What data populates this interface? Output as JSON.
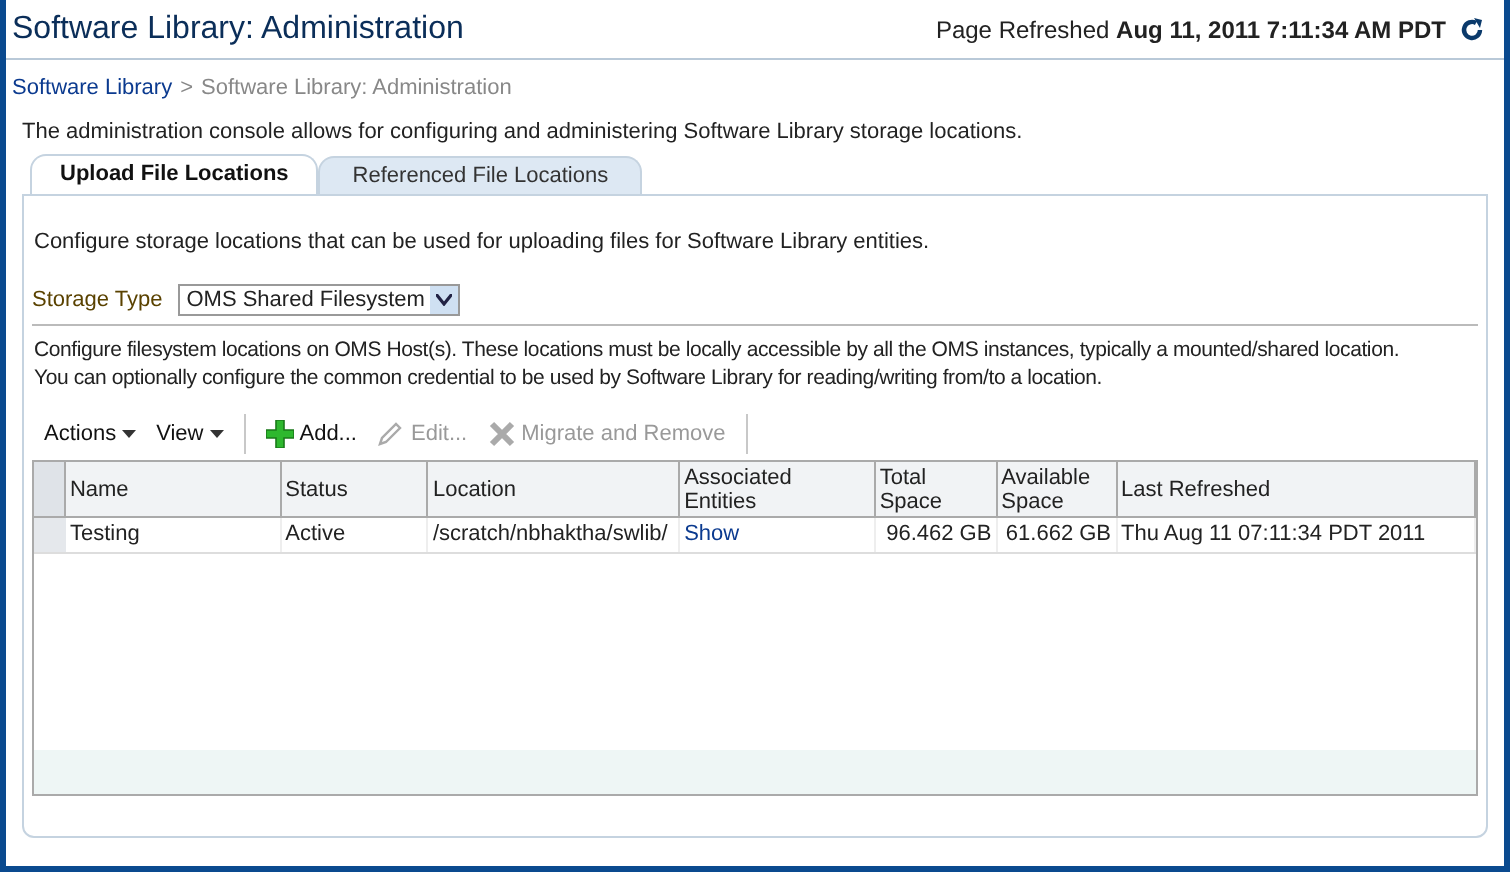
{
  "header": {
    "title": "Software Library: Administration",
    "refreshed_label": "Page Refreshed",
    "refreshed_time": "Aug 11, 2011 7:11:34 AM PDT"
  },
  "breadcrumb": [
    {
      "label": "Software Library",
      "link": true
    },
    {
      "label": ">",
      "link": false
    },
    {
      "label": "Software Library: Administration",
      "link": false
    }
  ],
  "description": "The administration console allows for configuring and administering Software Library storage locations.",
  "tabs": [
    {
      "label": "Upload File Locations",
      "selected": true
    },
    {
      "label": "Referenced File Locations",
      "selected": false
    }
  ],
  "panel": {
    "intro": "Configure storage locations that can be used for uploading files for Software Library entities.",
    "storage_type": {
      "label": "Storage Type",
      "value": "OMS Shared Filesystem"
    },
    "note_lines": [
      "Configure filesystem locations on OMS Host(s). These locations must be locally accessible by all the OMS instances, typically a mounted/shared location.",
      "You can optionally configure the common credential to be used by Software Library for  reading/writing from/to a location."
    ],
    "toolbar": [
      {
        "kind": "menu",
        "label": "Actions",
        "disabled": false
      },
      {
        "kind": "menu",
        "label": "View",
        "disabled": false
      },
      {
        "kind": "add",
        "label": "Add...",
        "disabled": false
      },
      {
        "kind": "edit",
        "label": "Edit...",
        "disabled": true
      },
      {
        "kind": "remove",
        "label": "Migrate and Remove",
        "disabled": true
      }
    ],
    "table": {
      "columns": [
        "Name",
        "Status",
        "Location",
        "Associated Entities",
        "Total Space",
        "Available Space",
        "Last Refreshed"
      ],
      "rows": [
        [
          "Testing",
          "Active",
          "/scratch/nbhaktha/swlib/",
          "Show",
          "96.462 GB",
          "61.662 GB",
          "Thu Aug 11 07:11:34 PDT 2011"
        ]
      ]
    }
  }
}
